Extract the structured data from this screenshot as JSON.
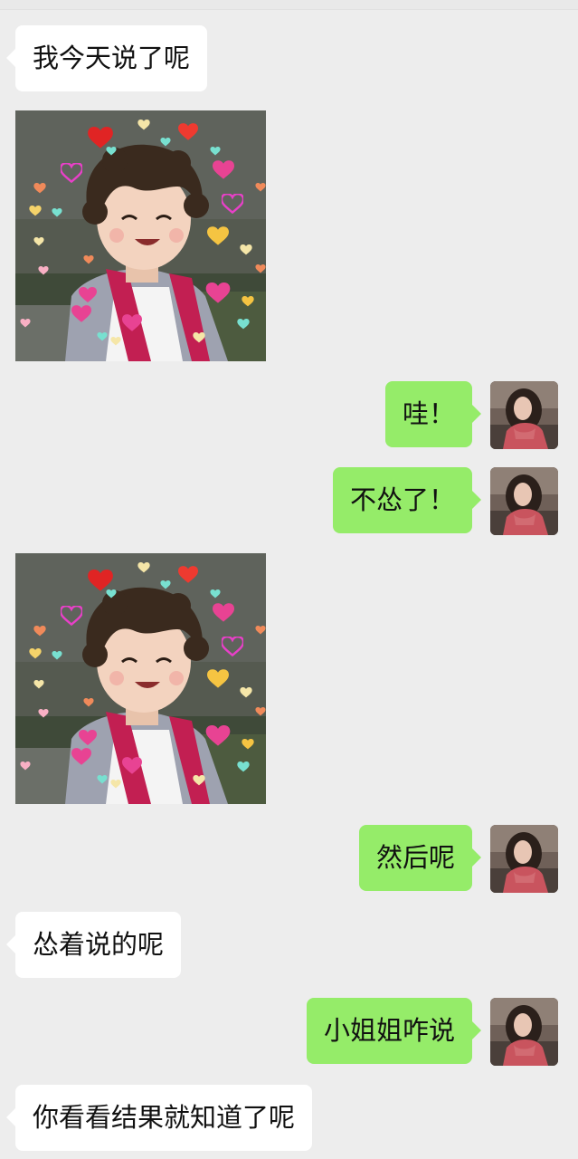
{
  "chat": {
    "messages": [
      {
        "side": "in",
        "type": "text",
        "text": "我今天说了呢"
      },
      {
        "side": "in",
        "type": "image",
        "image": "cute-curly-hair-kid-sticker-with-hearts"
      },
      {
        "side": "out",
        "type": "text",
        "text": "哇！"
      },
      {
        "side": "out",
        "type": "text",
        "text": "不怂了！"
      },
      {
        "side": "in",
        "type": "image",
        "image": "cute-curly-hair-kid-sticker-with-hearts"
      },
      {
        "side": "out",
        "type": "text",
        "text": "然后呢"
      },
      {
        "side": "in",
        "type": "text",
        "text": "怂着说的呢"
      },
      {
        "side": "out",
        "type": "text",
        "text": "小姐姐咋说"
      },
      {
        "side": "in",
        "type": "text",
        "text": "你看看结果就知道了呢"
      }
    ]
  },
  "colors": {
    "background": "#ededed",
    "incoming_bubble": "#ffffff",
    "outgoing_bubble": "#95ec69"
  },
  "icons": {
    "self_avatar": "girl-portrait-avatar",
    "sticker": "kid-with-hearts-sticker"
  }
}
